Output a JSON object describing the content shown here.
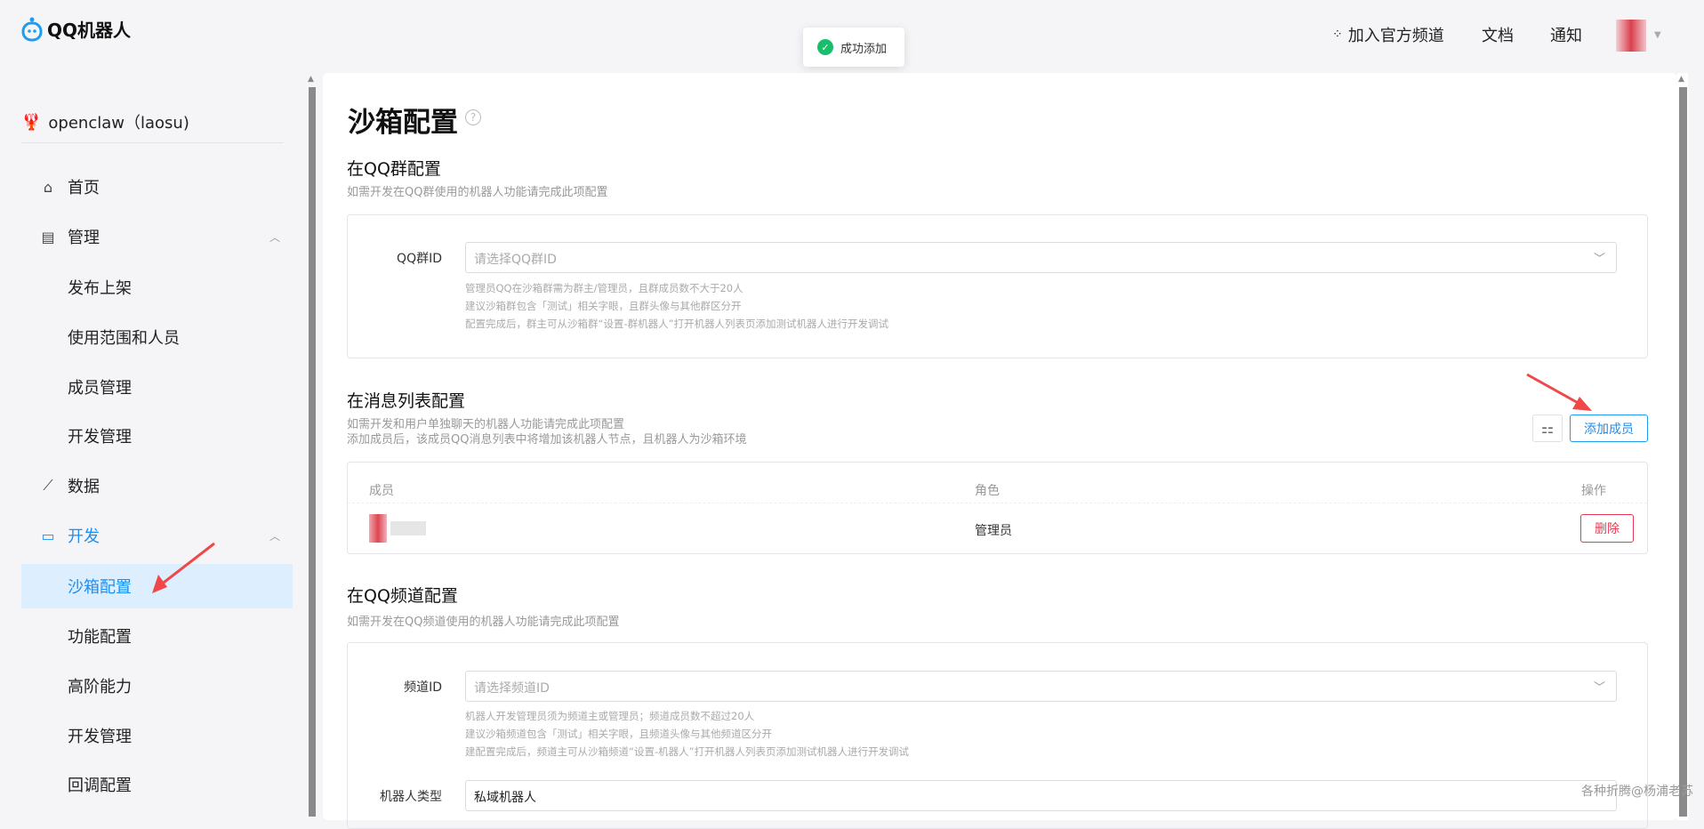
{
  "header": {
    "logo": "QQ机器人",
    "join_channel": "加入官方频道",
    "docs": "文档",
    "notify": "通知"
  },
  "toast": {
    "message": "成功添加",
    "icon": "check-circle-icon",
    "color": "#19be6b"
  },
  "project": {
    "name": "openclaw（laosu)"
  },
  "sidebar": {
    "items": [
      {
        "label": "首页",
        "icon": "home-icon"
      },
      {
        "label": "管理",
        "icon": "list-icon",
        "expanded": true
      },
      {
        "label": "发布上架"
      },
      {
        "label": "使用范围和人员"
      },
      {
        "label": "成员管理"
      },
      {
        "label": "开发管理"
      },
      {
        "label": "数据",
        "icon": "chart-icon"
      },
      {
        "label": "开发",
        "icon": "monitor-icon",
        "expanded": true
      },
      {
        "label": "沙箱配置",
        "active": true
      },
      {
        "label": "功能配置"
      },
      {
        "label": "高阶能力"
      },
      {
        "label": "开发管理"
      },
      {
        "label": "回调配置"
      }
    ]
  },
  "main": {
    "title": "沙箱配置",
    "group": {
      "title": "在QQ群配置",
      "desc": "如需开发在QQ群使用的机器人功能请完成此项配置",
      "label": "QQ群ID",
      "placeholder": "请选择QQ群ID",
      "hints": [
        "管理员QQ在沙箱群需为群主/管理员，且群成员数不大于20人",
        "建议沙箱群包含「测试」相关字眼，且群头像与其他群区分开",
        "配置完成后，群主可从沙箱群“设置-群机器人”打开机器人列表页添加测试机器人进行开发调试"
      ]
    },
    "msglist": {
      "title": "在消息列表配置",
      "desc1": "如需开发和用户单独聊天的机器人功能请完成此项配置",
      "desc2": "添加成员后，该成员QQ消息列表中将增加该机器人节点，且机器人为沙箱环境",
      "add_button": "添加成员",
      "columns": [
        "成员",
        "角色",
        "操作"
      ],
      "rows": [
        {
          "role": "管理员",
          "action": "删除"
        }
      ]
    },
    "channel": {
      "title": "在QQ频道配置",
      "desc": "如需开发在QQ频道使用的机器人功能请完成此项配置",
      "label": "频道ID",
      "placeholder": "请选择频道ID",
      "hints": [
        "机器人开发管理员须为频道主或管理员；频道成员数不超过20人",
        "建议沙箱频道包含「测试」相关字眼，且频道头像与其他频道区分开",
        "建配置完成后，频道主可从沙箱频道“设置-机器人”打开机器人列表页添加测试机器人进行开发调试"
      ],
      "type_label": "机器人类型",
      "type_value": "私域机器人"
    }
  },
  "watermark": "各种折腾@杨浦老苏",
  "colors": {
    "accent": "#1e8ef0",
    "danger": "#e83a52",
    "annotation_arrow": "#f04848"
  }
}
